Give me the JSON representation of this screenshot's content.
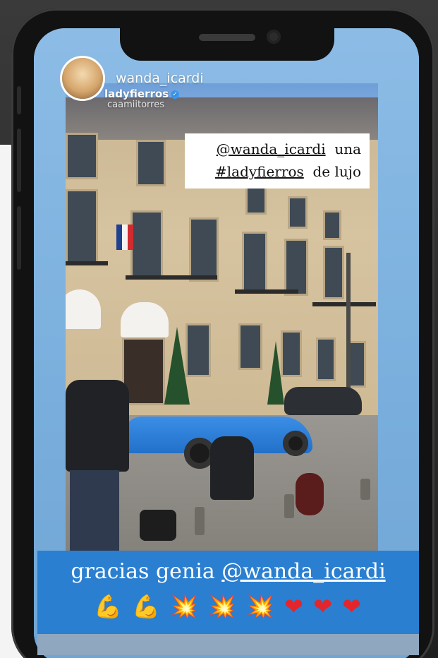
{
  "story": {
    "username": "wanda_icardi",
    "tagged_user": "ladyfierros",
    "tagged_user_2": "caamiitorres",
    "caption_line1_handle": "@wanda_icardi",
    "caption_line1_rest": "una",
    "caption_line2_tag": "#ladyfierros",
    "caption_line2_rest": "de lujo",
    "banner_prefix": "gracias genia ",
    "banner_handle": "@wanda_icardi",
    "emojis": [
      "💪",
      "💪",
      "💥",
      "💥",
      "💥",
      "❤",
      "❤",
      "❤"
    ]
  },
  "icons": {
    "avatar": "profile-avatar",
    "verified": "verified-badge"
  },
  "colors": {
    "banner": "#2a7fd1",
    "screen_bg": "#7fb2de",
    "verified": "#3897f0"
  }
}
